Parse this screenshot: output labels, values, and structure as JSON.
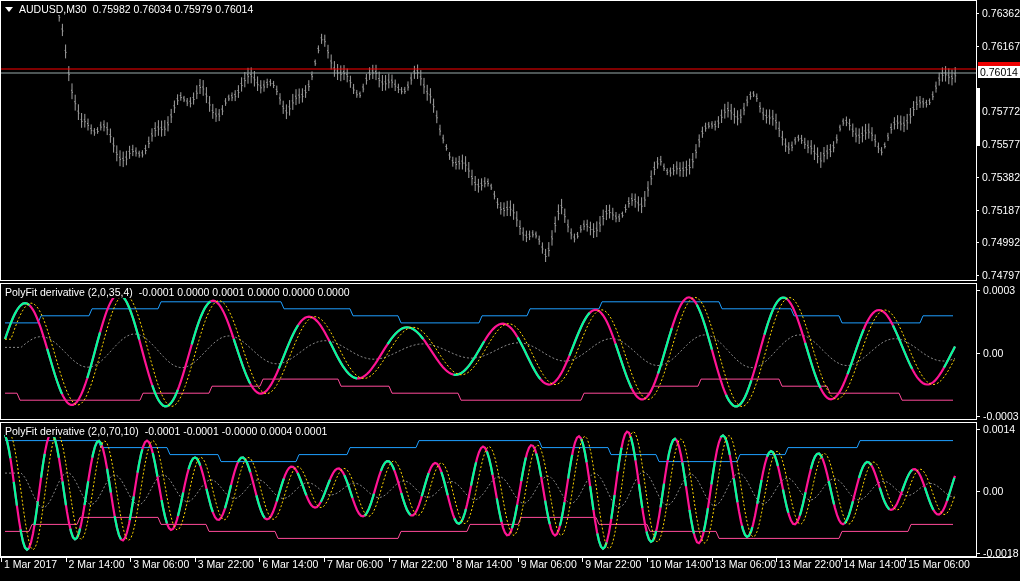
{
  "main_chart": {
    "symbol": "AUDUSD,M30",
    "quote": "0.75982 0.76034 0.75979 0.76014",
    "price_axis": [
      "0.76362",
      "0.76167",
      "0.75772",
      "0.75577",
      "0.75382",
      "0.75187",
      "0.74992",
      "0.74797"
    ],
    "current_price": "0.76014"
  },
  "indicators": [
    {
      "title": "PolyFit derivative (2,0,35,4)",
      "values": "-0.0001 0.0000 0.0001 0.0000 0.0000 0.0000",
      "axis": [
        "0.0003",
        "0.00",
        "-0.0003"
      ]
    },
    {
      "title": "PolyFit derivative (2,0,70,10)",
      "values": "-0.0001 -0.0001 -0.0000 0.0004 0.0001",
      "axis": [
        "0.0014",
        "0.00",
        "-0.0018"
      ]
    }
  ],
  "time_axis": [
    "1 Mar 2017",
    "2 Mar 14:00",
    "3 Mar 06:00",
    "3 Mar 22:00",
    "6 Mar 14:00",
    "7 Mar 06:00",
    "7 Mar 22:00",
    "8 Mar 14:00",
    "9 Mar 06:00",
    "9 Mar 22:00",
    "10 Mar 14:00",
    "13 Mar 06:00",
    "13 Mar 22:00",
    "14 Mar 14:00",
    "15 Mar 06:00"
  ]
}
